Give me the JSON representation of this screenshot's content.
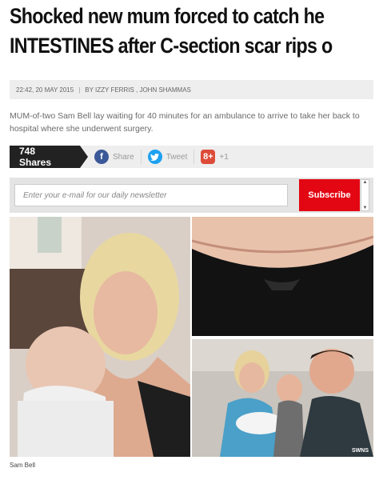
{
  "article": {
    "headline_line1": "Shocked new mum forced to catch he",
    "headline_line2": "INTESTINES after C-section scar rips o",
    "timestamp": "22:42, 20 MAY 2015",
    "byline": "BY IZZY FERRIS , JOHN SHAMMAS",
    "standfirst": "MUM-of-two Sam Bell lay waiting for 40 minutes for an ambulance to arrive to take her back to hospital where she underwent surgery."
  },
  "share": {
    "count_label": "748 Shares",
    "facebook_label": "Share",
    "twitter_label": "Tweet",
    "googleplus_label": "+1",
    "colors": {
      "facebook": "#3b5998",
      "twitter": "#1da1f2",
      "googleplus": "#dd4b39"
    }
  },
  "newsletter": {
    "placeholder": "Enter your e-mail for our daily newsletter",
    "subscribe_label": "Subscribe",
    "accent": "#e30613"
  },
  "photos": {
    "watermark": "SWNS",
    "caption": "Sam Bell"
  },
  "icons": {
    "facebook": "facebook-icon",
    "twitter": "twitter-icon",
    "googleplus": "google-plus-icon"
  }
}
